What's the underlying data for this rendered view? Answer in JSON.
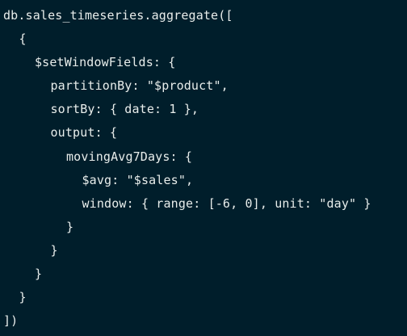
{
  "editor": {
    "background": "#001e2b",
    "text_color": "#e8edeb",
    "lines": [
      {
        "indent": 0,
        "text": "db.sales_timeseries.aggregate(["
      },
      {
        "indent": 1,
        "text": "{"
      },
      {
        "indent": 2,
        "text": "$setWindowFields: {"
      },
      {
        "indent": 3,
        "text": "partitionBy: \"$product\","
      },
      {
        "indent": 3,
        "text": "sortBy: { date: 1 },"
      },
      {
        "indent": 3,
        "text": "output: {"
      },
      {
        "indent": 4,
        "text": "movingAvg7Days: {"
      },
      {
        "indent": 5,
        "text": "$avg: \"$sales\","
      },
      {
        "indent": 5,
        "text": "window: { range: [-6, 0], unit: \"day\" }"
      },
      {
        "indent": 4,
        "text": "}"
      },
      {
        "indent": 3,
        "text": "}"
      },
      {
        "indent": 2,
        "text": "}"
      },
      {
        "indent": 1,
        "text": "}"
      },
      {
        "indent": 0,
        "text": "])"
      }
    ]
  }
}
